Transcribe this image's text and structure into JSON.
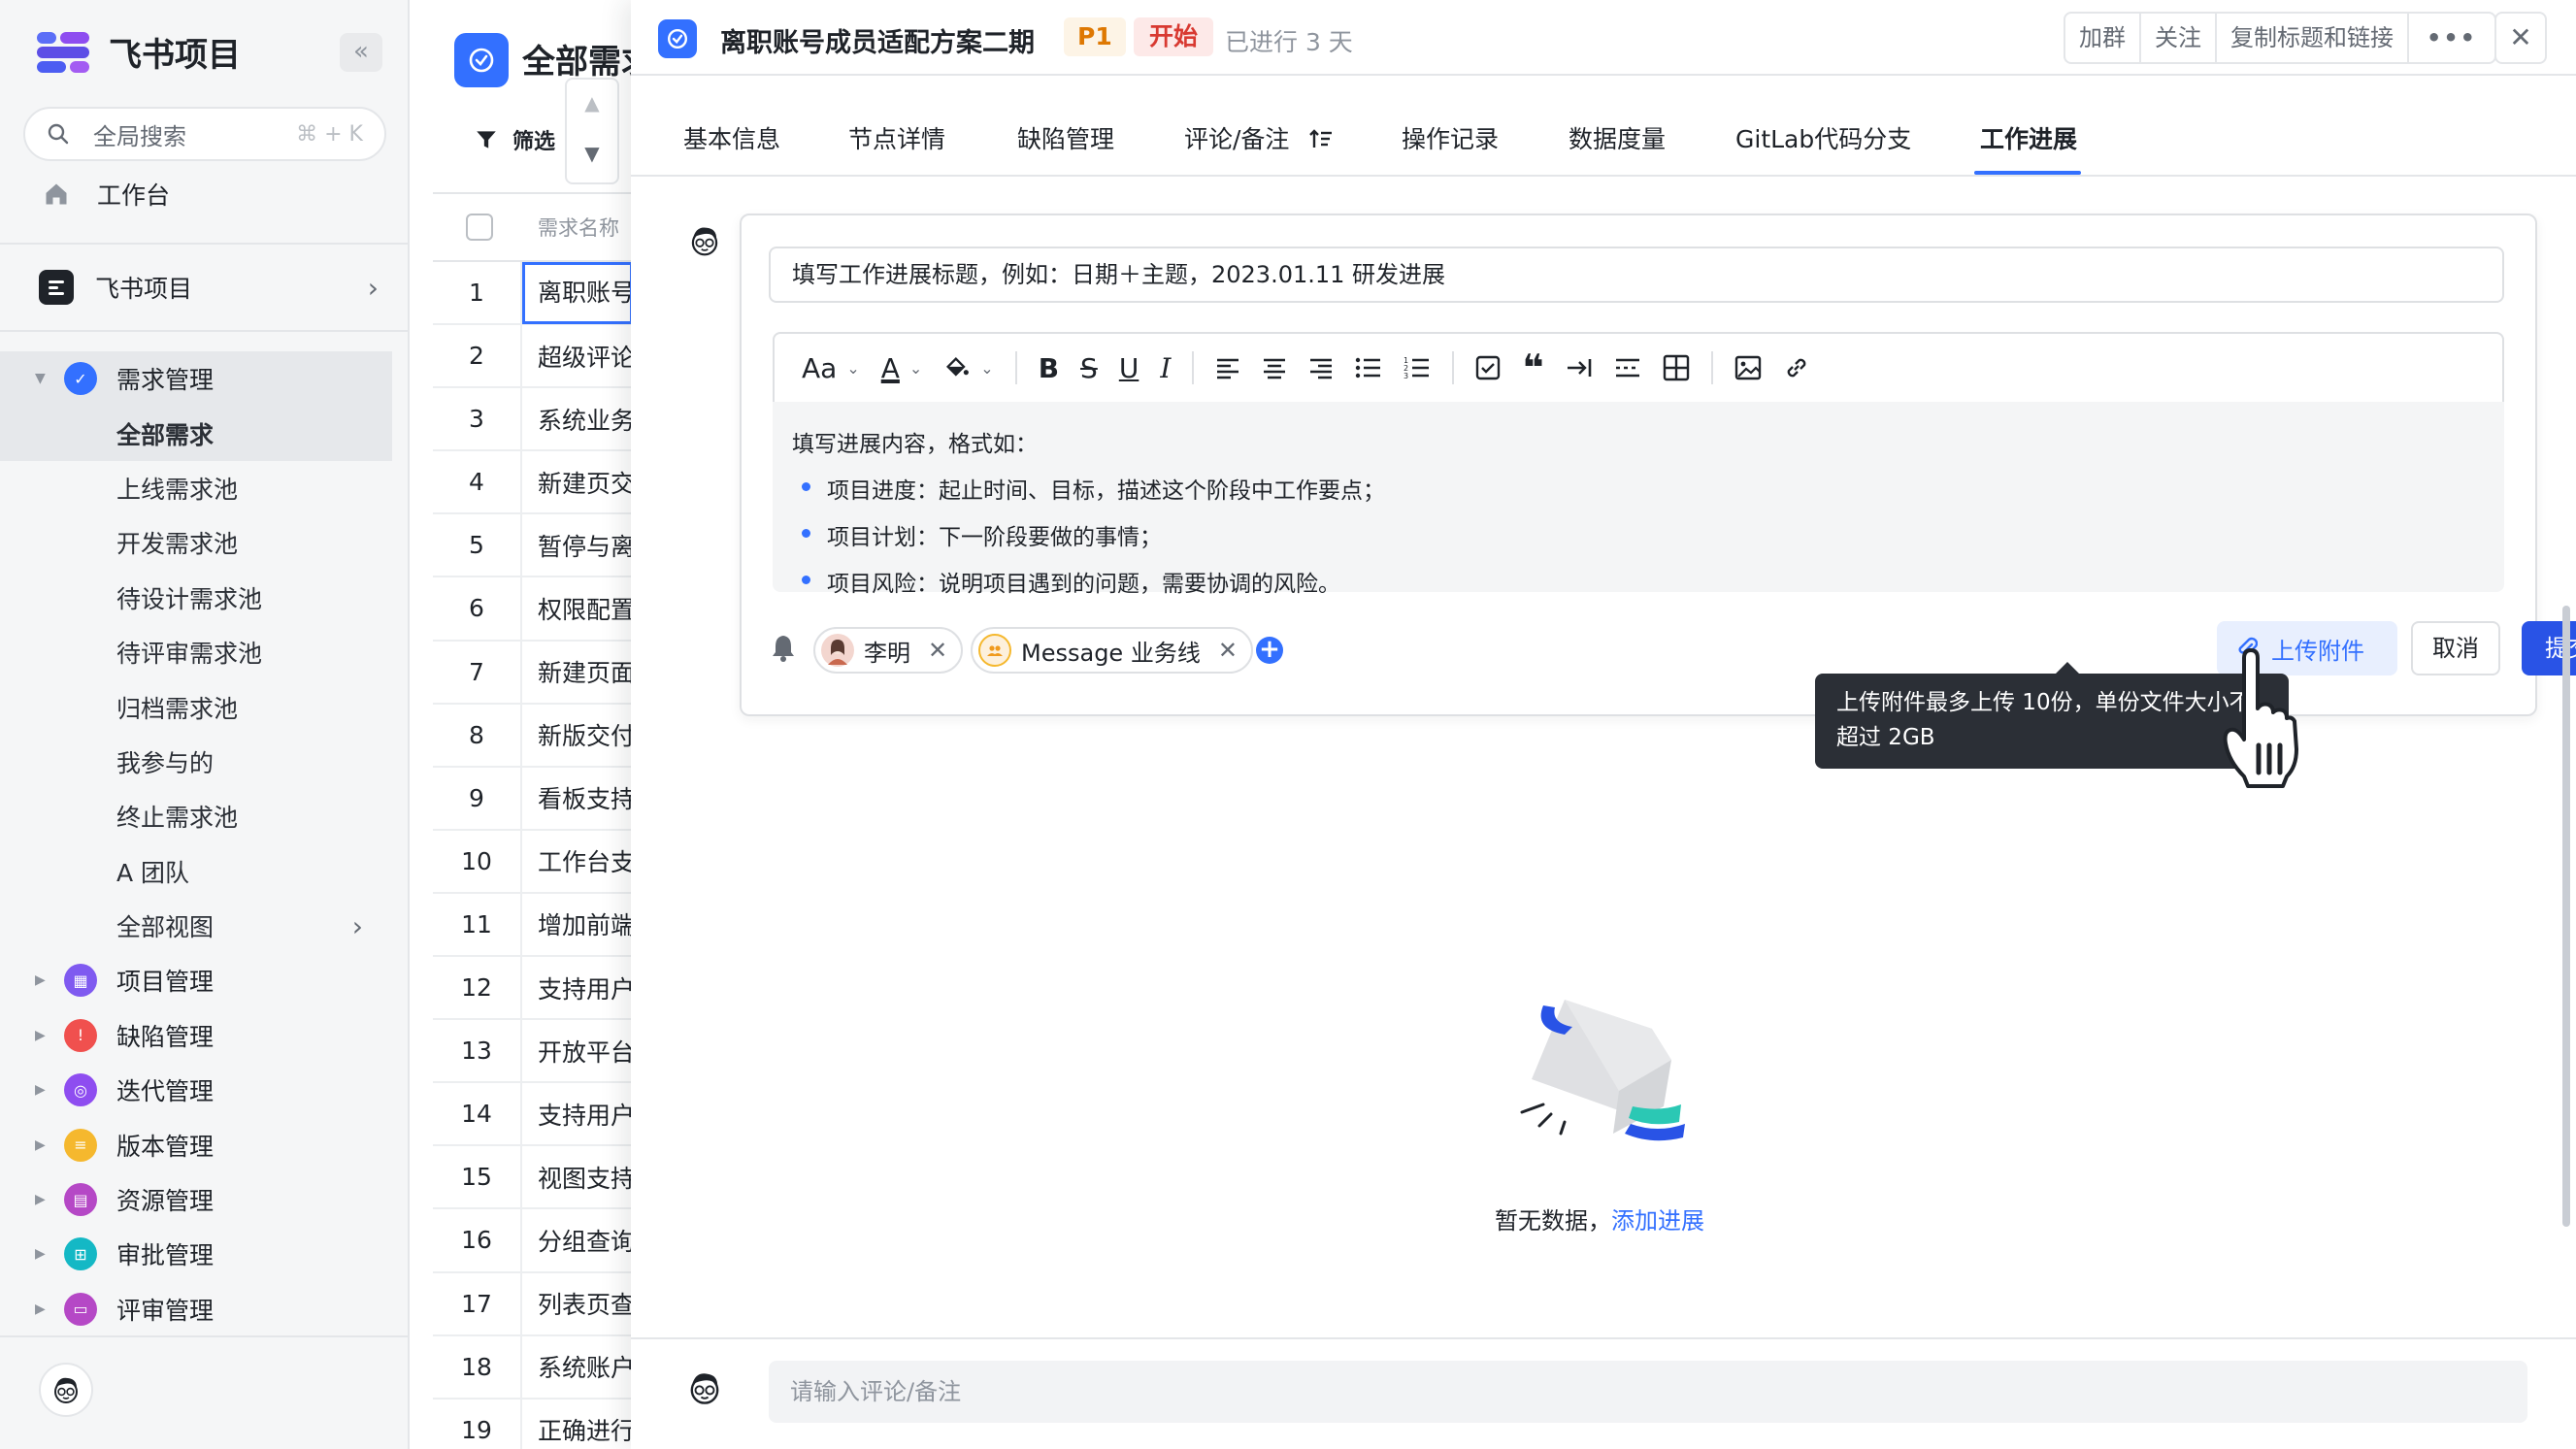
{
  "app": {
    "name": "飞书项目",
    "search_placeholder": "全局搜索",
    "search_shortcut": "⌘ + K",
    "workbench": "工作台",
    "space_name": "飞书项目"
  },
  "sidebar": {
    "items": [
      {
        "label": "需求管理",
        "icon": "requirement-icon",
        "color": "#3370ff"
      },
      {
        "label": "全部需求"
      },
      {
        "label": "上线需求池"
      },
      {
        "label": "开发需求池"
      },
      {
        "label": "待设计需求池"
      },
      {
        "label": "待评审需求池"
      },
      {
        "label": "归档需求池"
      },
      {
        "label": "我参与的"
      },
      {
        "label": "终止需求池"
      },
      {
        "label": "A 团队"
      },
      {
        "label": "全部视图"
      },
      {
        "label": "项目管理",
        "icon": "project-icon",
        "color": "#7f5af0"
      },
      {
        "label": "缺陷管理",
        "icon": "bug-icon",
        "color": "#f0504e"
      },
      {
        "label": "迭代管理",
        "icon": "iteration-icon",
        "color": "#8e4df0"
      },
      {
        "label": "版本管理",
        "icon": "version-icon",
        "color": "#f5b82e"
      },
      {
        "label": "资源管理",
        "icon": "resource-icon",
        "color": "#b548c6"
      },
      {
        "label": "审批管理",
        "icon": "approval-icon",
        "color": "#14b8c5"
      },
      {
        "label": "评审管理",
        "icon": "review-icon",
        "color": "#b548c6"
      }
    ]
  },
  "list": {
    "title": "全部需求",
    "filter_label": "筛选",
    "column_name": "需求名称",
    "rows": [
      {
        "idx": "1",
        "name": "离职账号"
      },
      {
        "idx": "2",
        "name": "超级评论"
      },
      {
        "idx": "3",
        "name": "系统业务"
      },
      {
        "idx": "4",
        "name": "新建页交"
      },
      {
        "idx": "5",
        "name": "暂停与离"
      },
      {
        "idx": "6",
        "name": "权限配置"
      },
      {
        "idx": "7",
        "name": "新建页面"
      },
      {
        "idx": "8",
        "name": "新版交付"
      },
      {
        "idx": "9",
        "name": "看板支持"
      },
      {
        "idx": "10",
        "name": "工作台支"
      },
      {
        "idx": "11",
        "name": "增加前端"
      },
      {
        "idx": "12",
        "name": "支持用户"
      },
      {
        "idx": "13",
        "name": "开放平台"
      },
      {
        "idx": "14",
        "name": "支持用户"
      },
      {
        "idx": "15",
        "name": "视图支持"
      },
      {
        "idx": "16",
        "name": "分组查询"
      },
      {
        "idx": "17",
        "name": "列表页查"
      },
      {
        "idx": "18",
        "name": "系统账户"
      },
      {
        "idx": "19",
        "name": "正确进行"
      }
    ]
  },
  "detail": {
    "title": "离职账号成员适配方案二期",
    "priority": "P1",
    "status": "开始",
    "elapsed": "已进行 3 天",
    "actions": [
      "加群",
      "关注",
      "复制标题和链接",
      "•••"
    ],
    "close": "✕",
    "tabs": [
      "基本信息",
      "节点详情",
      "缺陷管理",
      "评论/备注",
      "操作记录",
      "数据度量",
      "GitLab代码分支",
      "工作进展"
    ],
    "active_tab": "工作进展"
  },
  "editor": {
    "title_placeholder": "填写工作进展标题，例如：日期＋主题，2023.01.11 研发进展",
    "content_hint": "填写进展内容，格式如：",
    "bullets": [
      "项目进度：起止时间、目标，描述这个阶段中工作要点；",
      "项目计划：下一阶段要做的事情；",
      "项目风险：说明项目遇到的问题，需要协调的风险。"
    ],
    "mentions": [
      {
        "label": "李明"
      },
      {
        "label": "Message 业务线"
      }
    ],
    "upload_label": "上传附件",
    "cancel_label": "取消",
    "submit_label": "提交",
    "tooltip": "上传附件最多上传 10份，单份文件大小不超过 2GB"
  },
  "empty": {
    "text": "暂无数据，",
    "link": "添加进展"
  },
  "comment": {
    "placeholder": "请输入评论/备注"
  },
  "colors": {
    "accent": "#3370ff",
    "priority": "#de7802",
    "status": "#d83931",
    "submit": "#2953e6"
  }
}
